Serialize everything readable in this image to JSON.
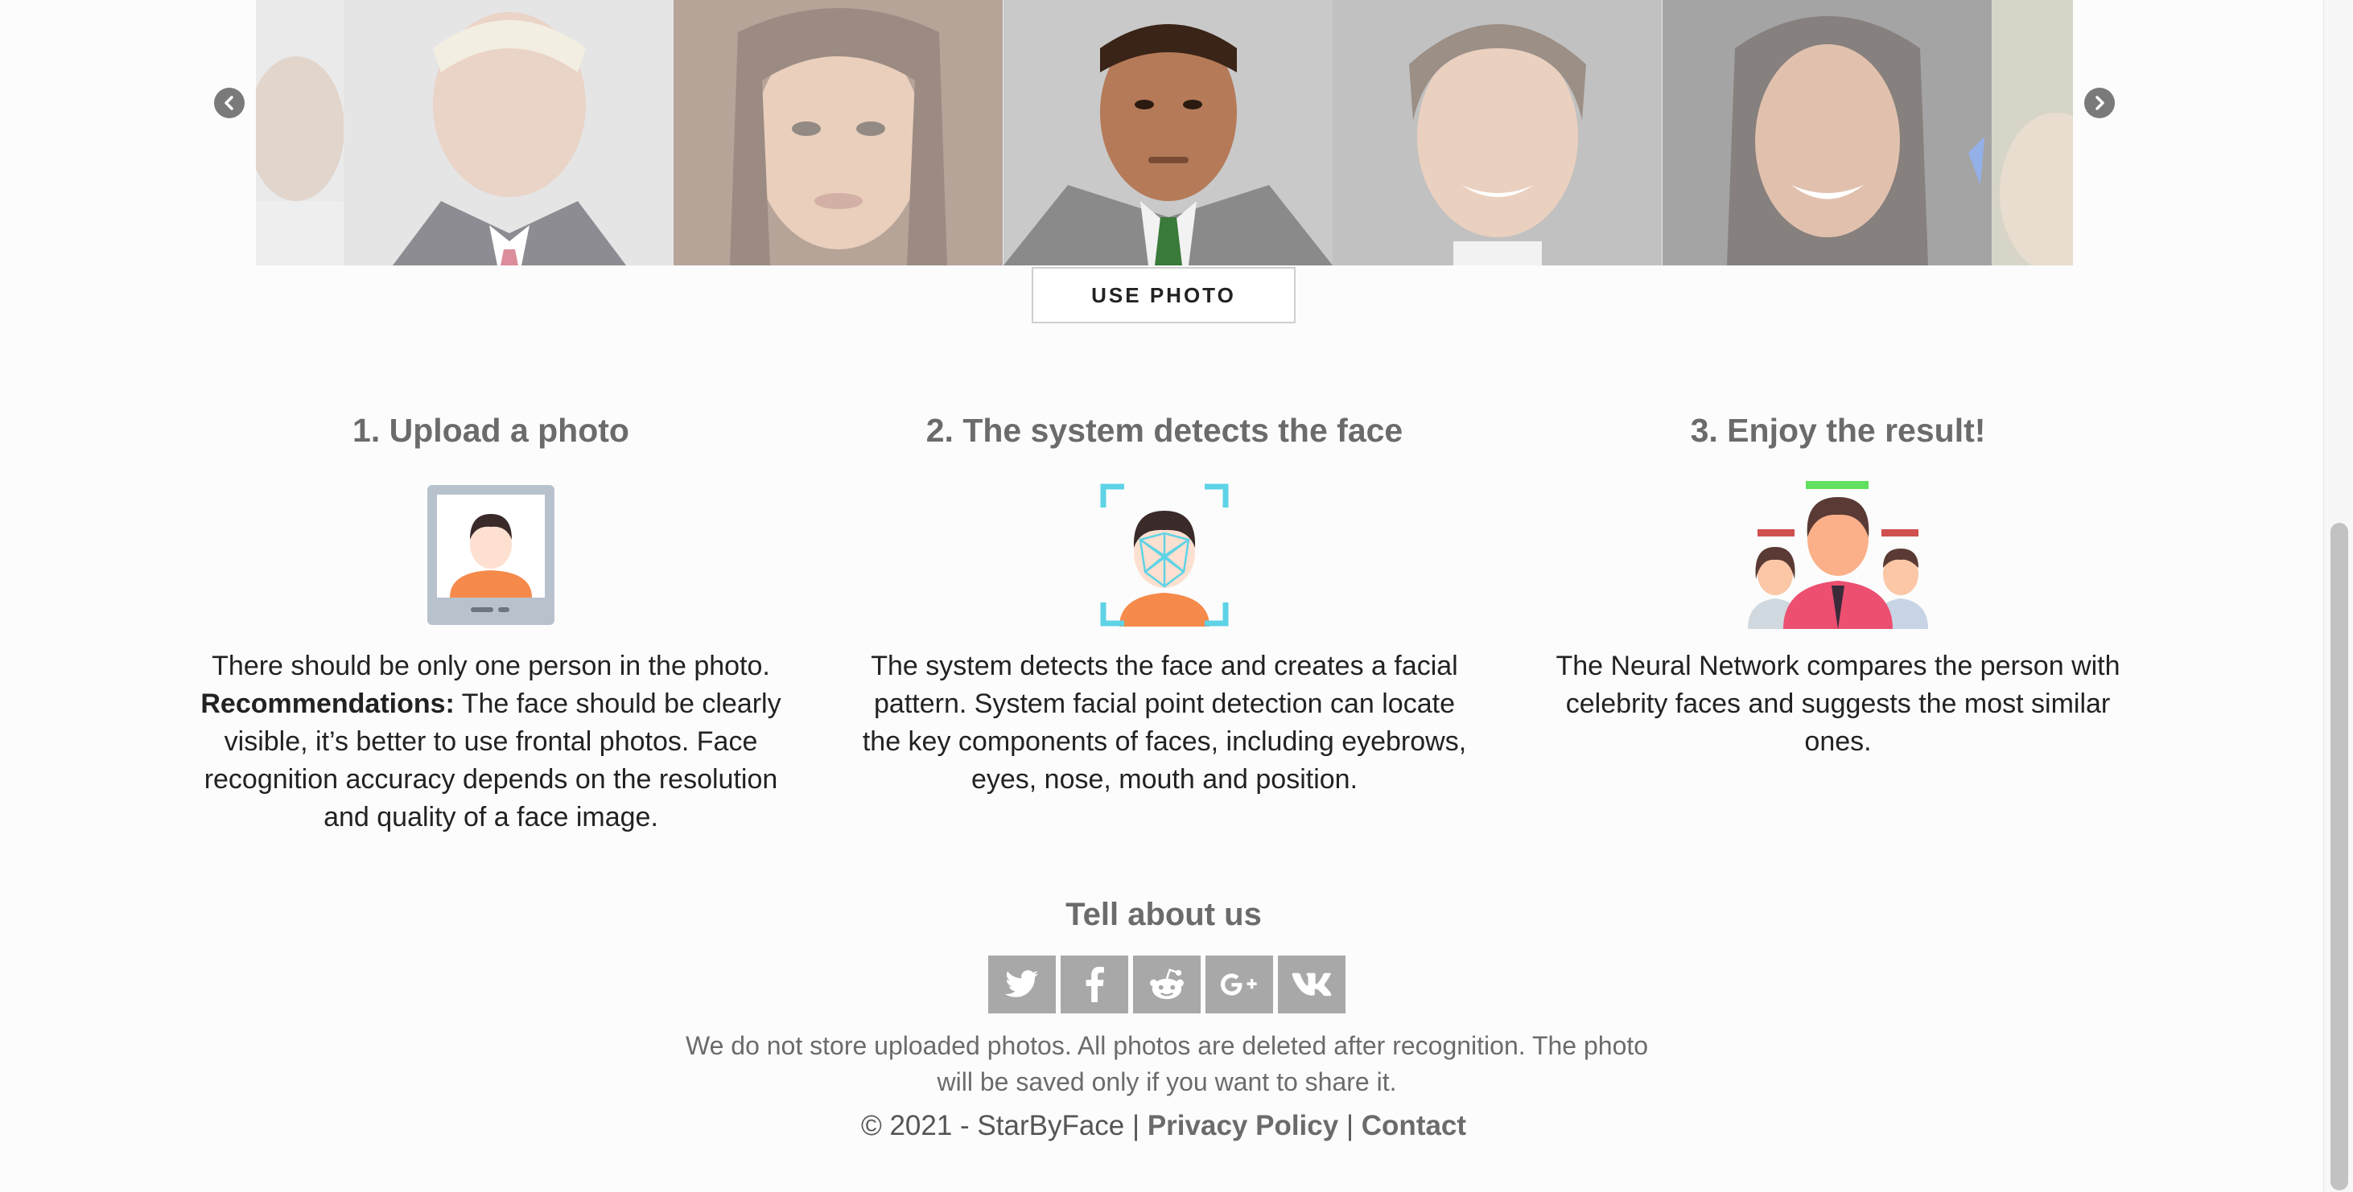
{
  "carousel": {
    "prev_icon": "chevron-left-icon",
    "next_icon": "chevron-right-icon",
    "use_photo_label": "USE PHOTO"
  },
  "steps": [
    {
      "title": "1. Upload a photo",
      "icon": "portrait-photo-icon",
      "text_before": "There should be only one person in the photo.",
      "bold": "Recommendations:",
      "text_after": " The face should be clearly visible, it’s better to use frontal photos. Face recognition accuracy depends on the resolution and quality of a face image."
    },
    {
      "title": "2. The system detects the face",
      "icon": "face-scan-icon",
      "text": "The system detects the face and creates a facial pattern. System facial point detection can locate the key components of faces, including eyebrows, eyes, nose, mouth and position."
    },
    {
      "title": "3. Enjoy the result!",
      "icon": "people-comparison-icon",
      "text": "The Neural Network compares the person with celebrity faces and suggests the most similar ones."
    }
  ],
  "footer": {
    "tell_title": "Tell about us",
    "social": [
      "twitter-icon",
      "facebook-icon",
      "reddit-icon",
      "google-plus-icon",
      "vk-icon"
    ],
    "notice": "We do not store uploaded photos. All photos are deleted after recognition. The photo will be saved only if you want to share it.",
    "copyright": "© 2021 - StarByFace",
    "sep1": "|",
    "privacy": "Privacy Policy",
    "sep2": "|",
    "contact": "Contact"
  }
}
